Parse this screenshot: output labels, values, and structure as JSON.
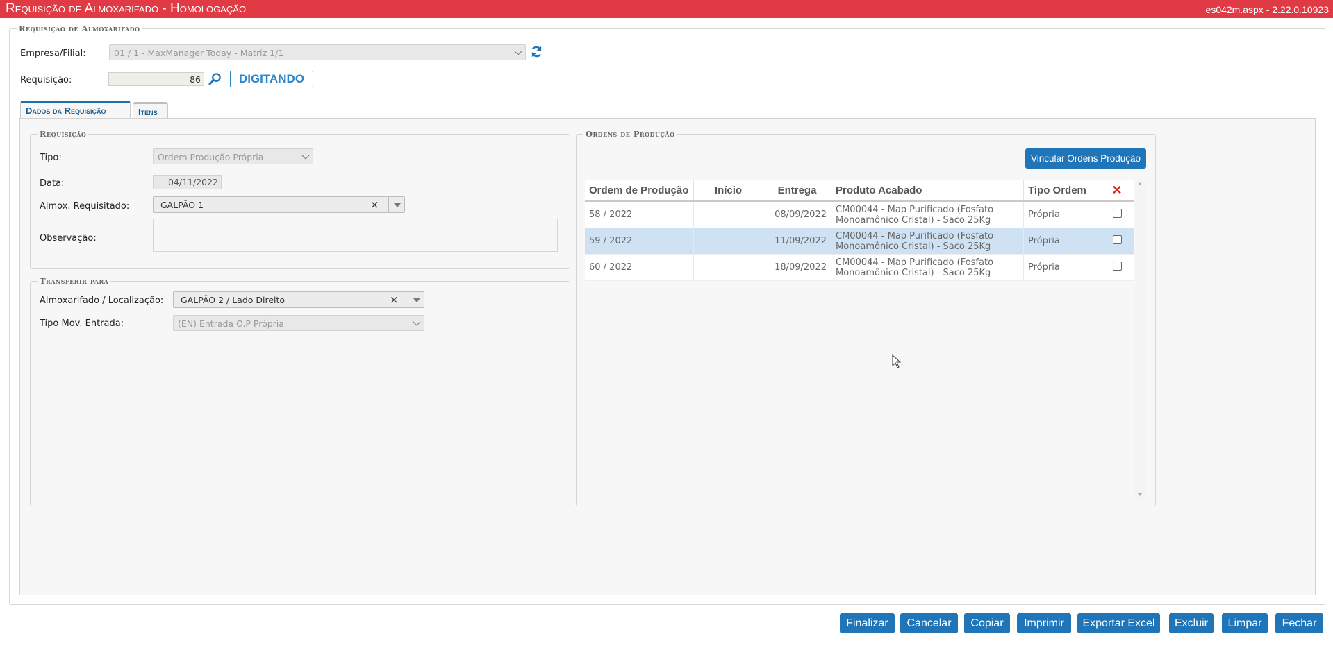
{
  "titlebar": {
    "title": "Requisição de Almoxarifado  - Homologação",
    "version": "es042m.aspx - 2.22.0.10923"
  },
  "main_legend": "Requisição de Almoxarifado",
  "empresa": {
    "label": "Empresa/Filial:",
    "value": "01 / 1 - MaxManager Today - Matriz 1/1"
  },
  "requisicao": {
    "label": "Requisição:",
    "value": "86",
    "status": "DIGITANDO"
  },
  "tabs": [
    {
      "label": "Dados da Requisição"
    },
    {
      "label": "Itens"
    }
  ],
  "req_section": {
    "legend": "Requisição",
    "tipo_label": "Tipo:",
    "tipo_value": "Ordem Produção Própria",
    "data_label": "Data:",
    "data_value": "04/11/2022",
    "almox_label": "Almox. Requisitado:",
    "almox_value": "GALPÃO 1",
    "obs_label": "Observação:",
    "obs_value": ""
  },
  "transfer_section": {
    "legend": "Transferir para",
    "almox_label": "Almoxarifado / Localização:",
    "almox_value": "GALPÃO 2 / Lado Direito",
    "tipo_label": "Tipo Mov. Entrada:",
    "tipo_value": "(EN) Entrada O.P Própria"
  },
  "ordens": {
    "legend": "Ordens de Produção",
    "link_button": "Vincular Ordens Produção",
    "columns": [
      "Ordem de Produção",
      "Início",
      "Entrega",
      "Produto Acabado",
      "Tipo Ordem",
      "✕"
    ],
    "rows": [
      {
        "ordem": "58 / 2022",
        "inicio": "",
        "entrega": "08/09/2022",
        "produto_l1": "CM00044 - Map Purificado (Fosfato",
        "produto_l2": "Monoamônico Cristal) - Saco 25Kg",
        "tipo": "Própria",
        "checked": false
      },
      {
        "ordem": "59 / 2022",
        "inicio": "",
        "entrega": "11/09/2022",
        "produto_l1": "CM00044 - Map Purificado (Fosfato",
        "produto_l2": "Monoamônico Cristal) - Saco 25Kg",
        "tipo": "Própria",
        "checked": false
      },
      {
        "ordem": "60 / 2022",
        "inicio": "",
        "entrega": "18/09/2022",
        "produto_l1": "CM00044 - Map Purificado (Fosfato",
        "produto_l2": "Monoamônico Cristal) - Saco 25Kg",
        "tipo": "Própria",
        "checked": false
      }
    ]
  },
  "footer_buttons": [
    "Finalizar",
    "Cancelar",
    "Copiar",
    "Imprimir",
    "Exportar Excel",
    "Excluir",
    "Limpar",
    "Fechar"
  ],
  "colors": {
    "titlebar": "#e03a44",
    "accent": "#1f75b7",
    "row_highlight": "#cfe2f3"
  }
}
